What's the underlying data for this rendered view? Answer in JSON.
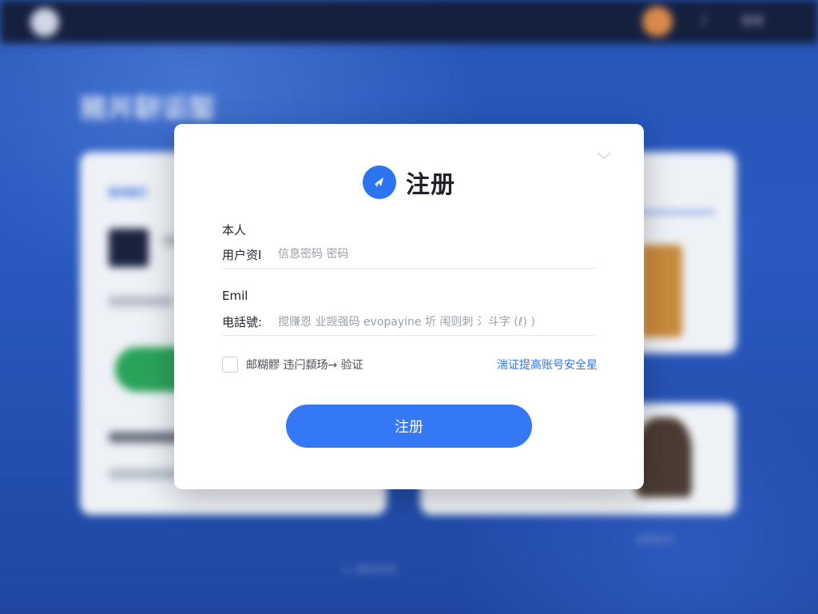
{
  "background": {
    "title": "豬丼駢诟鍫",
    "card_link": "BiNE扌",
    "top_link": "登录",
    "bottom_text": "© 版权所有",
    "bottom_right": "查看更多"
  },
  "modal": {
    "title": "注册",
    "fields": [
      {
        "label": "本人",
        "prefix": "用户资I",
        "placeholder": "信息密码 密码",
        "value": ""
      },
      {
        "label": "Emil",
        "prefix": "电話號:",
        "placeholder": "",
        "value": "搅赚恩 业觊强码 evopayine 圻 闱则刺 氵斗字 (ℓ) )"
      }
    ],
    "checkbox_text": "邮糊髎 违闩纇玚→ 验证",
    "checkbox_checked": false,
    "link_text": "湍证提高账号安全星",
    "submit_label": "注册"
  },
  "icons": {
    "brand": "brand-logo-icon",
    "close": "chevron-down-icon"
  },
  "colors": {
    "accent": "#3478f6",
    "brand_icon": "#2d74f0",
    "link": "#2d74f0",
    "backdrop": "#2654b6"
  }
}
